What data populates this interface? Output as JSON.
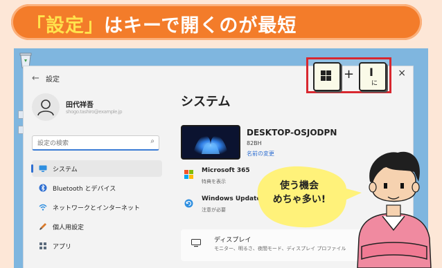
{
  "banner": {
    "highlight": "「設定」",
    "rest": "はキーで開くのが最短"
  },
  "window": {
    "title": "設定",
    "close_glyph": "×",
    "back_glyph": "←"
  },
  "user": {
    "name": "田代祥吾",
    "email": "shogo.tashiro@example.jp"
  },
  "search": {
    "placeholder": "設定の検索"
  },
  "nav": [
    {
      "label": "システム",
      "icon": "system-icon",
      "active": true
    },
    {
      "label": "Bluetooth とデバイス",
      "icon": "bluetooth-icon"
    },
    {
      "label": "ネットワークとインターネット",
      "icon": "network-icon"
    },
    {
      "label": "個人用設定",
      "icon": "personalize-icon"
    },
    {
      "label": "アプリ",
      "icon": "apps-icon"
    }
  ],
  "content": {
    "title": "システム",
    "device": {
      "name": "DESKTOP-OSJODPN",
      "model": "82BH",
      "rename": "名前の変更"
    },
    "cards": [
      {
        "title": "Microsoft 365",
        "subtitle": "特典を表示"
      },
      {
        "title": "Windows Update",
        "subtitle": "注意が必要"
      }
    ],
    "display": {
      "title": "ディスプレイ",
      "subtitle": "モニター、明るさ、夜間モード、ディスプレイ プロファイル"
    }
  },
  "keys": {
    "plus": "+",
    "i_top": "I",
    "i_sub": "に"
  },
  "bubble": {
    "line1": "使う機会",
    "line2": "めちゃ多い!"
  },
  "colors": {
    "banner_bg": "#f37c2a",
    "banner_highlight": "#ffe34d",
    "accent": "#2f6fd1",
    "key_frame": "#d8272f",
    "bubble": "#fff27a",
    "shirt": "#f08aa0"
  }
}
